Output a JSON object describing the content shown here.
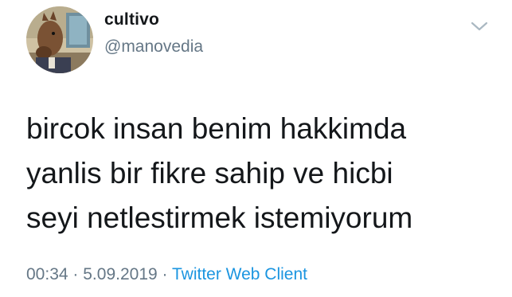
{
  "user": {
    "display_name": "cultivo",
    "handle": "@manovedia",
    "avatar_icon": "horse-character-avatar"
  },
  "menu": {
    "icon": "chevron-down-icon"
  },
  "tweet": {
    "lines": [
      "bircok insan benim hakkimda",
      "yanlis bir fikre sahip ve hicbi",
      "seyi netlestirmek istemiyorum"
    ]
  },
  "meta": {
    "time": "00:34",
    "separator": "·",
    "date": "5.09.2019",
    "client": "Twitter Web Client"
  },
  "colors": {
    "text": "#14171a",
    "secondary": "#657786",
    "link": "#1b95e0",
    "background": "#ffffff"
  }
}
